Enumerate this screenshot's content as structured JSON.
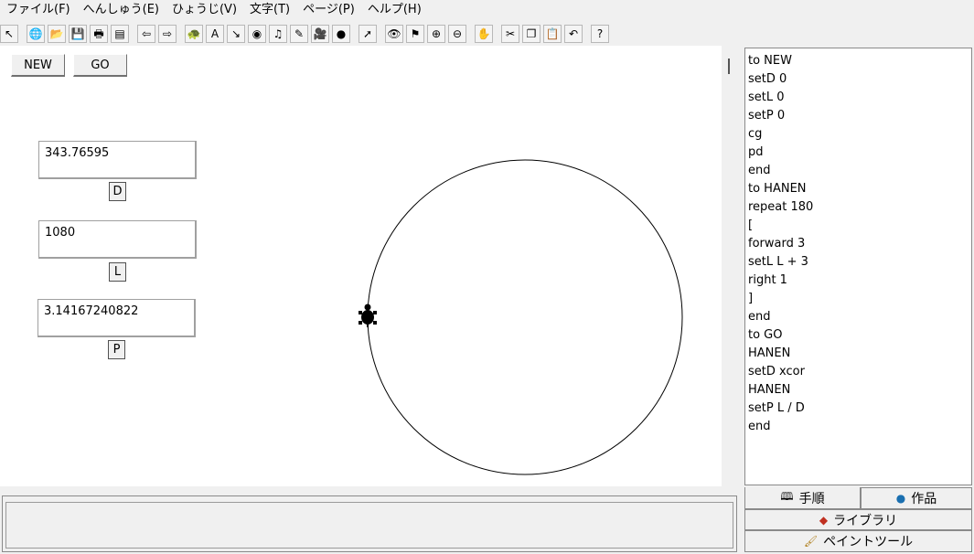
{
  "menu": [
    "ファイル(F)",
    "へんしゅう(E)",
    "ひょうじ(V)",
    "文字(T)",
    "ページ(P)",
    "ヘルプ(H)"
  ],
  "toolbar_groups": [
    [
      {
        "name": "select-arrow-icon",
        "glyph": "↖"
      }
    ],
    [
      {
        "name": "new-page-icon",
        "glyph": "🌐"
      },
      {
        "name": "open-folder-icon",
        "glyph": "📂"
      },
      {
        "name": "save-icon",
        "glyph": "💾"
      },
      {
        "name": "print-icon",
        "glyph": "🖶"
      },
      {
        "name": "page-list-icon",
        "glyph": "▤"
      }
    ],
    [
      {
        "name": "previous-page-icon",
        "glyph": "⇦"
      },
      {
        "name": "next-page-icon",
        "glyph": "⇨"
      }
    ],
    [
      {
        "name": "turtle-icon",
        "glyph": "🐢"
      },
      {
        "name": "text-box-icon",
        "glyph": "A"
      },
      {
        "name": "slider-icon",
        "glyph": "↘"
      },
      {
        "name": "eye-button-icon",
        "glyph": "◉"
      },
      {
        "name": "music-icon",
        "glyph": "♫"
      },
      {
        "name": "pen-icon",
        "glyph": "✎"
      },
      {
        "name": "movie-icon",
        "glyph": "🎥"
      },
      {
        "name": "globe-link-icon",
        "glyph": "●"
      }
    ],
    [
      {
        "name": "pointer-icon",
        "glyph": "➚"
      }
    ],
    [
      {
        "name": "eye-icon",
        "glyph": "👁"
      },
      {
        "name": "stamp-icon",
        "glyph": "⚑"
      },
      {
        "name": "zoom-in-icon",
        "glyph": "⊕"
      },
      {
        "name": "zoom-out-icon",
        "glyph": "⊖"
      }
    ],
    [
      {
        "name": "stop-hand-icon",
        "glyph": "✋"
      }
    ],
    [
      {
        "name": "cut-icon",
        "glyph": "✂"
      },
      {
        "name": "copy-icon",
        "glyph": "❐"
      },
      {
        "name": "paste-icon",
        "glyph": "📋"
      },
      {
        "name": "undo-icon",
        "glyph": "↶"
      }
    ],
    [
      {
        "name": "help-icon",
        "glyph": "?"
      }
    ]
  ],
  "buttons": {
    "new": "NEW",
    "go": "GO"
  },
  "variables": [
    {
      "value": "343.76595",
      "label": "D"
    },
    {
      "value": "1080",
      "label": "L"
    },
    {
      "value": "3.14167240822",
      "label": "P"
    }
  ],
  "procedures": [
    "to NEW",
    "setD 0",
    "setL 0",
    "setP 0",
    "cg",
    "pd",
    "end",
    "to HANEN",
    "repeat 180",
    "[",
    "forward 3",
    "setL L + 3",
    "right 1",
    "]",
    "end",
    "to GO",
    "HANEN",
    "setD xcor",
    "HANEN",
    "setP L / D",
    "end"
  ],
  "status_text": "",
  "tabs": {
    "procedures": {
      "label": "手順",
      "icon": "book-icon"
    },
    "projects": {
      "label": "作品",
      "icon": "globe-icon"
    },
    "library": {
      "label": "ライブラリ",
      "icon": "shapes-icon"
    },
    "paint": {
      "label": "ペイントツール",
      "icon": "paintbrush-icon"
    }
  }
}
